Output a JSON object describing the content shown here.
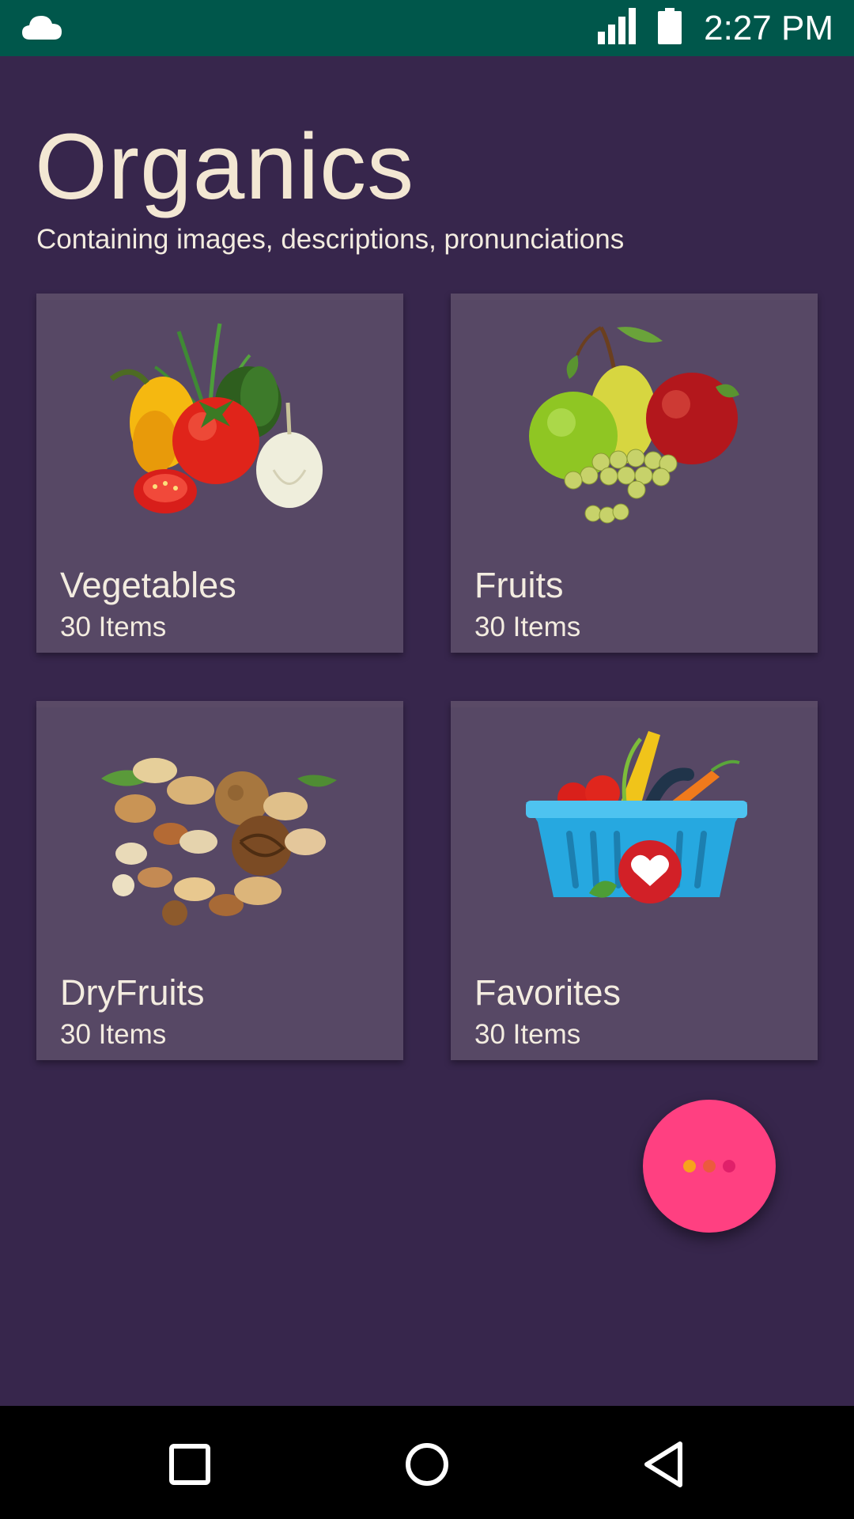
{
  "status_bar": {
    "time": "2:27 PM",
    "icons": [
      "cloud-icon",
      "signal-icon",
      "battery-icon"
    ],
    "background": "#00574b"
  },
  "header": {
    "title": "Organics",
    "subtitle": "Containing images, descriptions, pronunciations"
  },
  "categories": [
    {
      "name": "Vegetables",
      "count": "30 Items",
      "icon": "vegetables-image"
    },
    {
      "name": "Fruits",
      "count": "30 Items",
      "icon": "fruits-image"
    },
    {
      "name": "DryFruits",
      "count": "30 Items",
      "icon": "dryfruits-image"
    },
    {
      "name": "Favorites",
      "count": "30 Items",
      "icon": "favorites-basket-image"
    }
  ],
  "fab": {
    "icon": "more-dots-icon",
    "color": "#ff4081"
  },
  "nav_bar": {
    "icons": [
      "recents-square-icon",
      "home-circle-icon",
      "back-triangle-icon"
    ]
  },
  "colors": {
    "background": "#37264c",
    "card": "#574865",
    "text": "#f3ece0"
  }
}
